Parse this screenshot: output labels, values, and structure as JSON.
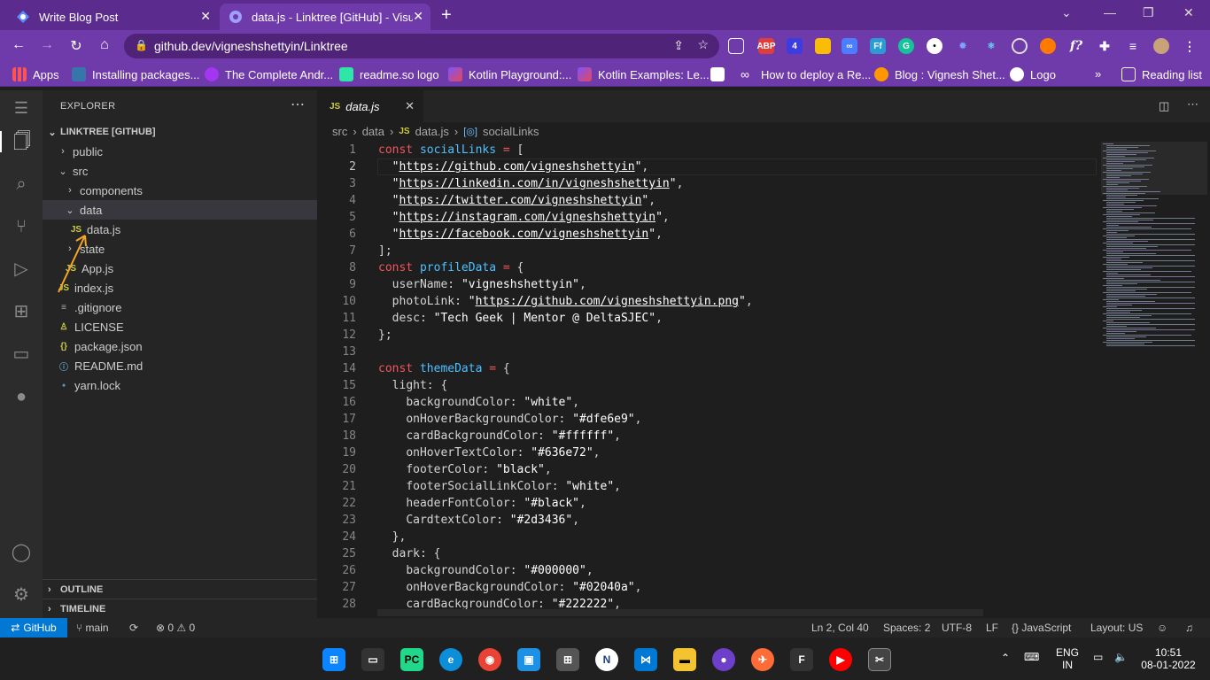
{
  "browser": {
    "tabs": [
      {
        "title": "Write Blog Post",
        "active": false
      },
      {
        "title": "data.js - Linktree [GitHub] - Visua",
        "active": true
      }
    ],
    "url": "github.dev/vigneshshettyin/Linktree",
    "extensions": [
      "ABP",
      "4",
      "Ff",
      "G",
      "f?"
    ],
    "bookmarks": [
      {
        "label": "Apps",
        "color": "#4285f4"
      },
      {
        "label": "Installing packages...",
        "color": "#3776ab"
      },
      {
        "label": "The Complete Andr...",
        "color": "#a435f0"
      },
      {
        "label": "readme.so logo",
        "color": "#2ee6a6"
      },
      {
        "label": "Kotlin Playground:...",
        "color": "#7f52ff"
      },
      {
        "label": "Kotlin Examples: Le...",
        "color": "#7f52ff"
      },
      {
        "label": "",
        "color": "#ffffff"
      },
      {
        "label": "How to deploy a Re...",
        "color": "#ffffff"
      },
      {
        "label": "Blog : Vignesh Shet...",
        "color": "#ff9800"
      },
      {
        "label": "Logo",
        "color": "#ffffff"
      }
    ],
    "reading_list": "Reading list"
  },
  "explorer": {
    "title": "EXPLORER",
    "root": "LINKTREE [GITHUB]",
    "items": [
      {
        "label": "public",
        "type": "folder",
        "expanded": false,
        "depth": 1
      },
      {
        "label": "src",
        "type": "folder",
        "expanded": true,
        "depth": 1
      },
      {
        "label": "components",
        "type": "folder",
        "expanded": false,
        "depth": 2
      },
      {
        "label": "data",
        "type": "folder",
        "expanded": true,
        "depth": 2
      },
      {
        "label": "data.js",
        "type": "js",
        "depth": 3
      },
      {
        "label": "state",
        "type": "folder",
        "expanded": false,
        "depth": 2
      },
      {
        "label": "App.js",
        "type": "js",
        "depth": 2
      },
      {
        "label": "index.js",
        "type": "js",
        "depth": 2
      },
      {
        "label": ".gitignore",
        "type": "git",
        "depth": 1
      },
      {
        "label": "LICENSE",
        "type": "license",
        "depth": 1
      },
      {
        "label": "package.json",
        "type": "json",
        "depth": 1
      },
      {
        "label": "README.md",
        "type": "info",
        "depth": 1
      },
      {
        "label": "yarn.lock",
        "type": "yarn",
        "depth": 1
      }
    ],
    "outline": "OUTLINE",
    "timeline": "TIMELINE"
  },
  "editor": {
    "tab": "data.js",
    "breadcrumb": [
      "src",
      "data",
      "data.js",
      "socialLinks"
    ],
    "lines": [
      "const socialLinks = [",
      "  \"https://github.com/vigneshshettyin\",",
      "  \"https://linkedin.com/in/vigneshshettyin\",",
      "  \"https://twitter.com/vigneshshettyin\",",
      "  \"https://instagram.com/vigneshshettyin\",",
      "  \"https://facebook.com/vigneshshettyin\",",
      "];",
      "const profileData = {",
      "  userName: \"vigneshshettyin\",",
      "  photoLink: \"https://github.com/vigneshshettyin.png\",",
      "  desc: \"Tech Geek | Mentor @ DeltaSJEC\",",
      "};",
      "",
      "const themeData = {",
      "  light: {",
      "    backgroundColor: \"white\",",
      "    onHoverBackgroundColor: \"#dfe6e9\",",
      "    cardBackgroundColor: \"#ffffff\",",
      "    onHoverTextColor: \"#636e72\",",
      "    footerColor: \"black\",",
      "    footerSocialLinkColor: \"white\",",
      "    headerFontColor: \"#black\",",
      "    CardtextColor: \"#2d3436\",",
      "  },",
      "  dark: {",
      "    backgroundColor: \"#000000\",",
      "    onHoverBackgroundColor: \"#02040a\",",
      "    cardBackgroundColor: \"#222222\","
    ],
    "first_line_number": 1,
    "current_line": 2
  },
  "status": {
    "remote": "GitHub",
    "branch": "main",
    "problems": "0",
    "warnings": "0",
    "position": "Ln 2, Col 40",
    "spaces": "Spaces: 2",
    "encoding": "UTF-8",
    "eol": "LF",
    "language": "JavaScript",
    "layout": "Layout: US"
  },
  "taskbar": {
    "language": "ENG",
    "region": "IN",
    "time": "10:51",
    "date": "08-01-2022"
  }
}
